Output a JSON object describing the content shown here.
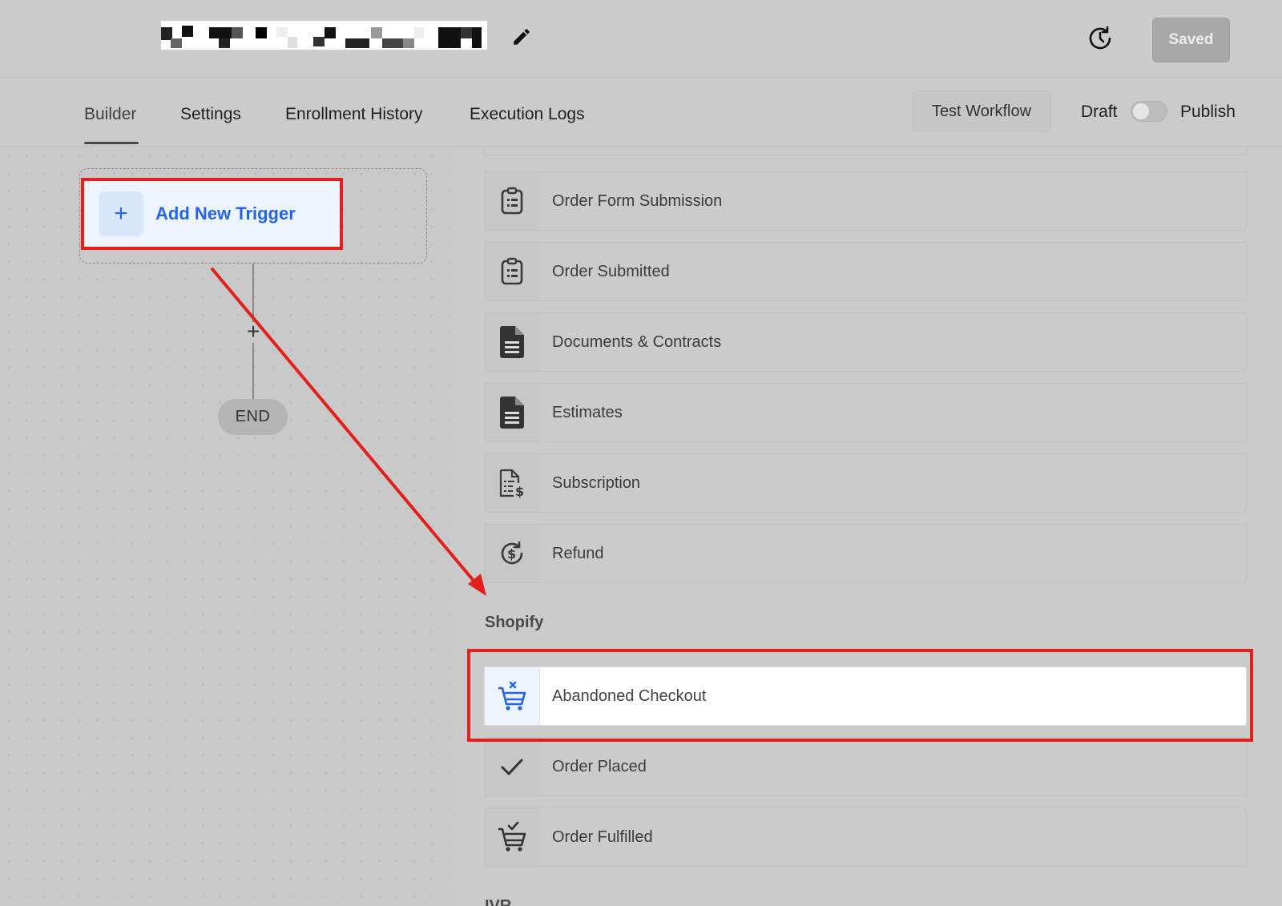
{
  "header": {
    "saved_label": "Saved"
  },
  "tabs": [
    {
      "label": "Builder",
      "active": true
    },
    {
      "label": "Settings",
      "active": false
    },
    {
      "label": "Enrollment History",
      "active": false
    },
    {
      "label": "Execution Logs",
      "active": false
    }
  ],
  "actions": {
    "test_workflow": "Test Workflow",
    "draft": "Draft",
    "publish": "Publish",
    "publish_toggle_on": false
  },
  "canvas": {
    "add_trigger_label": "Add New Trigger",
    "add_icon": "+",
    "end_label": "END"
  },
  "triggers": [
    {
      "label": "Order Form Submission",
      "icon": "clipboard-list-icon"
    },
    {
      "label": "Order Submitted",
      "icon": "clipboard-list-icon"
    },
    {
      "label": "Documents & Contracts",
      "icon": "document-icon"
    },
    {
      "label": "Estimates",
      "icon": "document-icon"
    },
    {
      "label": "Subscription",
      "icon": "invoice-dollar-icon"
    },
    {
      "label": "Refund",
      "icon": "refund-icon"
    }
  ],
  "shopify": {
    "title": "Shopify",
    "items": [
      {
        "label": "Abandoned Checkout",
        "icon": "cart-x-icon",
        "highlighted": true
      },
      {
        "label": "Order Placed",
        "icon": "checkmark-icon",
        "highlighted": false
      },
      {
        "label": "Order Fulfilled",
        "icon": "cart-check-icon",
        "highlighted": false
      }
    ]
  },
  "next_section_title": "IVR",
  "colors": {
    "accent": "#2563eb",
    "annotation_red": "#e3201b"
  }
}
